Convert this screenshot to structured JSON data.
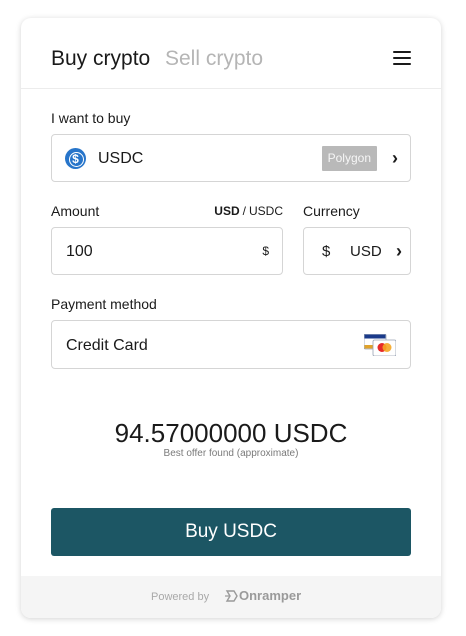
{
  "header": {
    "tabs": [
      {
        "label": "Buy crypto",
        "active": true
      },
      {
        "label": "Sell crypto",
        "active": false
      }
    ],
    "menu_icon": "hamburger-menu-icon"
  },
  "asset": {
    "label": "I want to buy",
    "code": "USDC",
    "network": "Polygon",
    "icon": "usdc-coin-icon"
  },
  "amount": {
    "label": "Amount",
    "value": "100",
    "symbol": "$",
    "unit_active": "USD",
    "unit_separator": "/",
    "unit_other": "USDC"
  },
  "currency": {
    "label": "Currency",
    "symbol": "$",
    "code": "USD"
  },
  "payment": {
    "label": "Payment method",
    "value": "Credit Card",
    "icon": "visa-mastercard-icon"
  },
  "quote": {
    "amount": "94.57000000 USDC",
    "note": "Best offer found (approximate)"
  },
  "cta": {
    "label": "Buy USDC"
  },
  "footer": {
    "powered_by": "Powered by",
    "brand": "Onramper"
  },
  "colors": {
    "primary": "#1c5664",
    "usdc_blue": "#2775ca",
    "badge_grey": "#b9b9b9",
    "muted_text": "#b5b5b5"
  }
}
